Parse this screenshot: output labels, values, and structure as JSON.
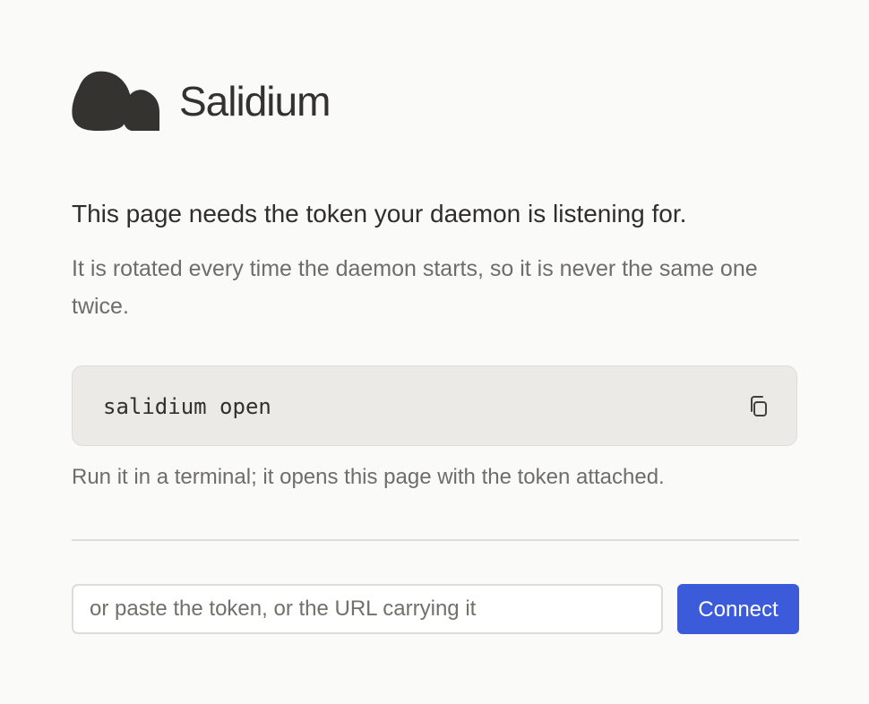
{
  "brand": {
    "name": "Salidium",
    "logo_icon": "salidium-rock-logo-icon",
    "logo_color": "#34332f"
  },
  "intro": {
    "headline": "This page needs the token your daemon is listening for.",
    "subtext": "It is rotated every time the daemon starts, so it is never the same one twice."
  },
  "command": {
    "text": "salidium open",
    "copy_icon": "copy-icon",
    "help": "Run it in a terminal; it opens this page with the token attached."
  },
  "token_form": {
    "placeholder": "or paste the token, or the URL carrying it",
    "value": "",
    "connect_label": "Connect"
  },
  "colors": {
    "background": "#fafaf9",
    "text": "#33322e",
    "muted_text": "#6e6d69",
    "command_background": "#ebeae6",
    "border": "#dedcd8",
    "primary_button": "#3b5bdb",
    "primary_button_text": "#ffffff"
  }
}
